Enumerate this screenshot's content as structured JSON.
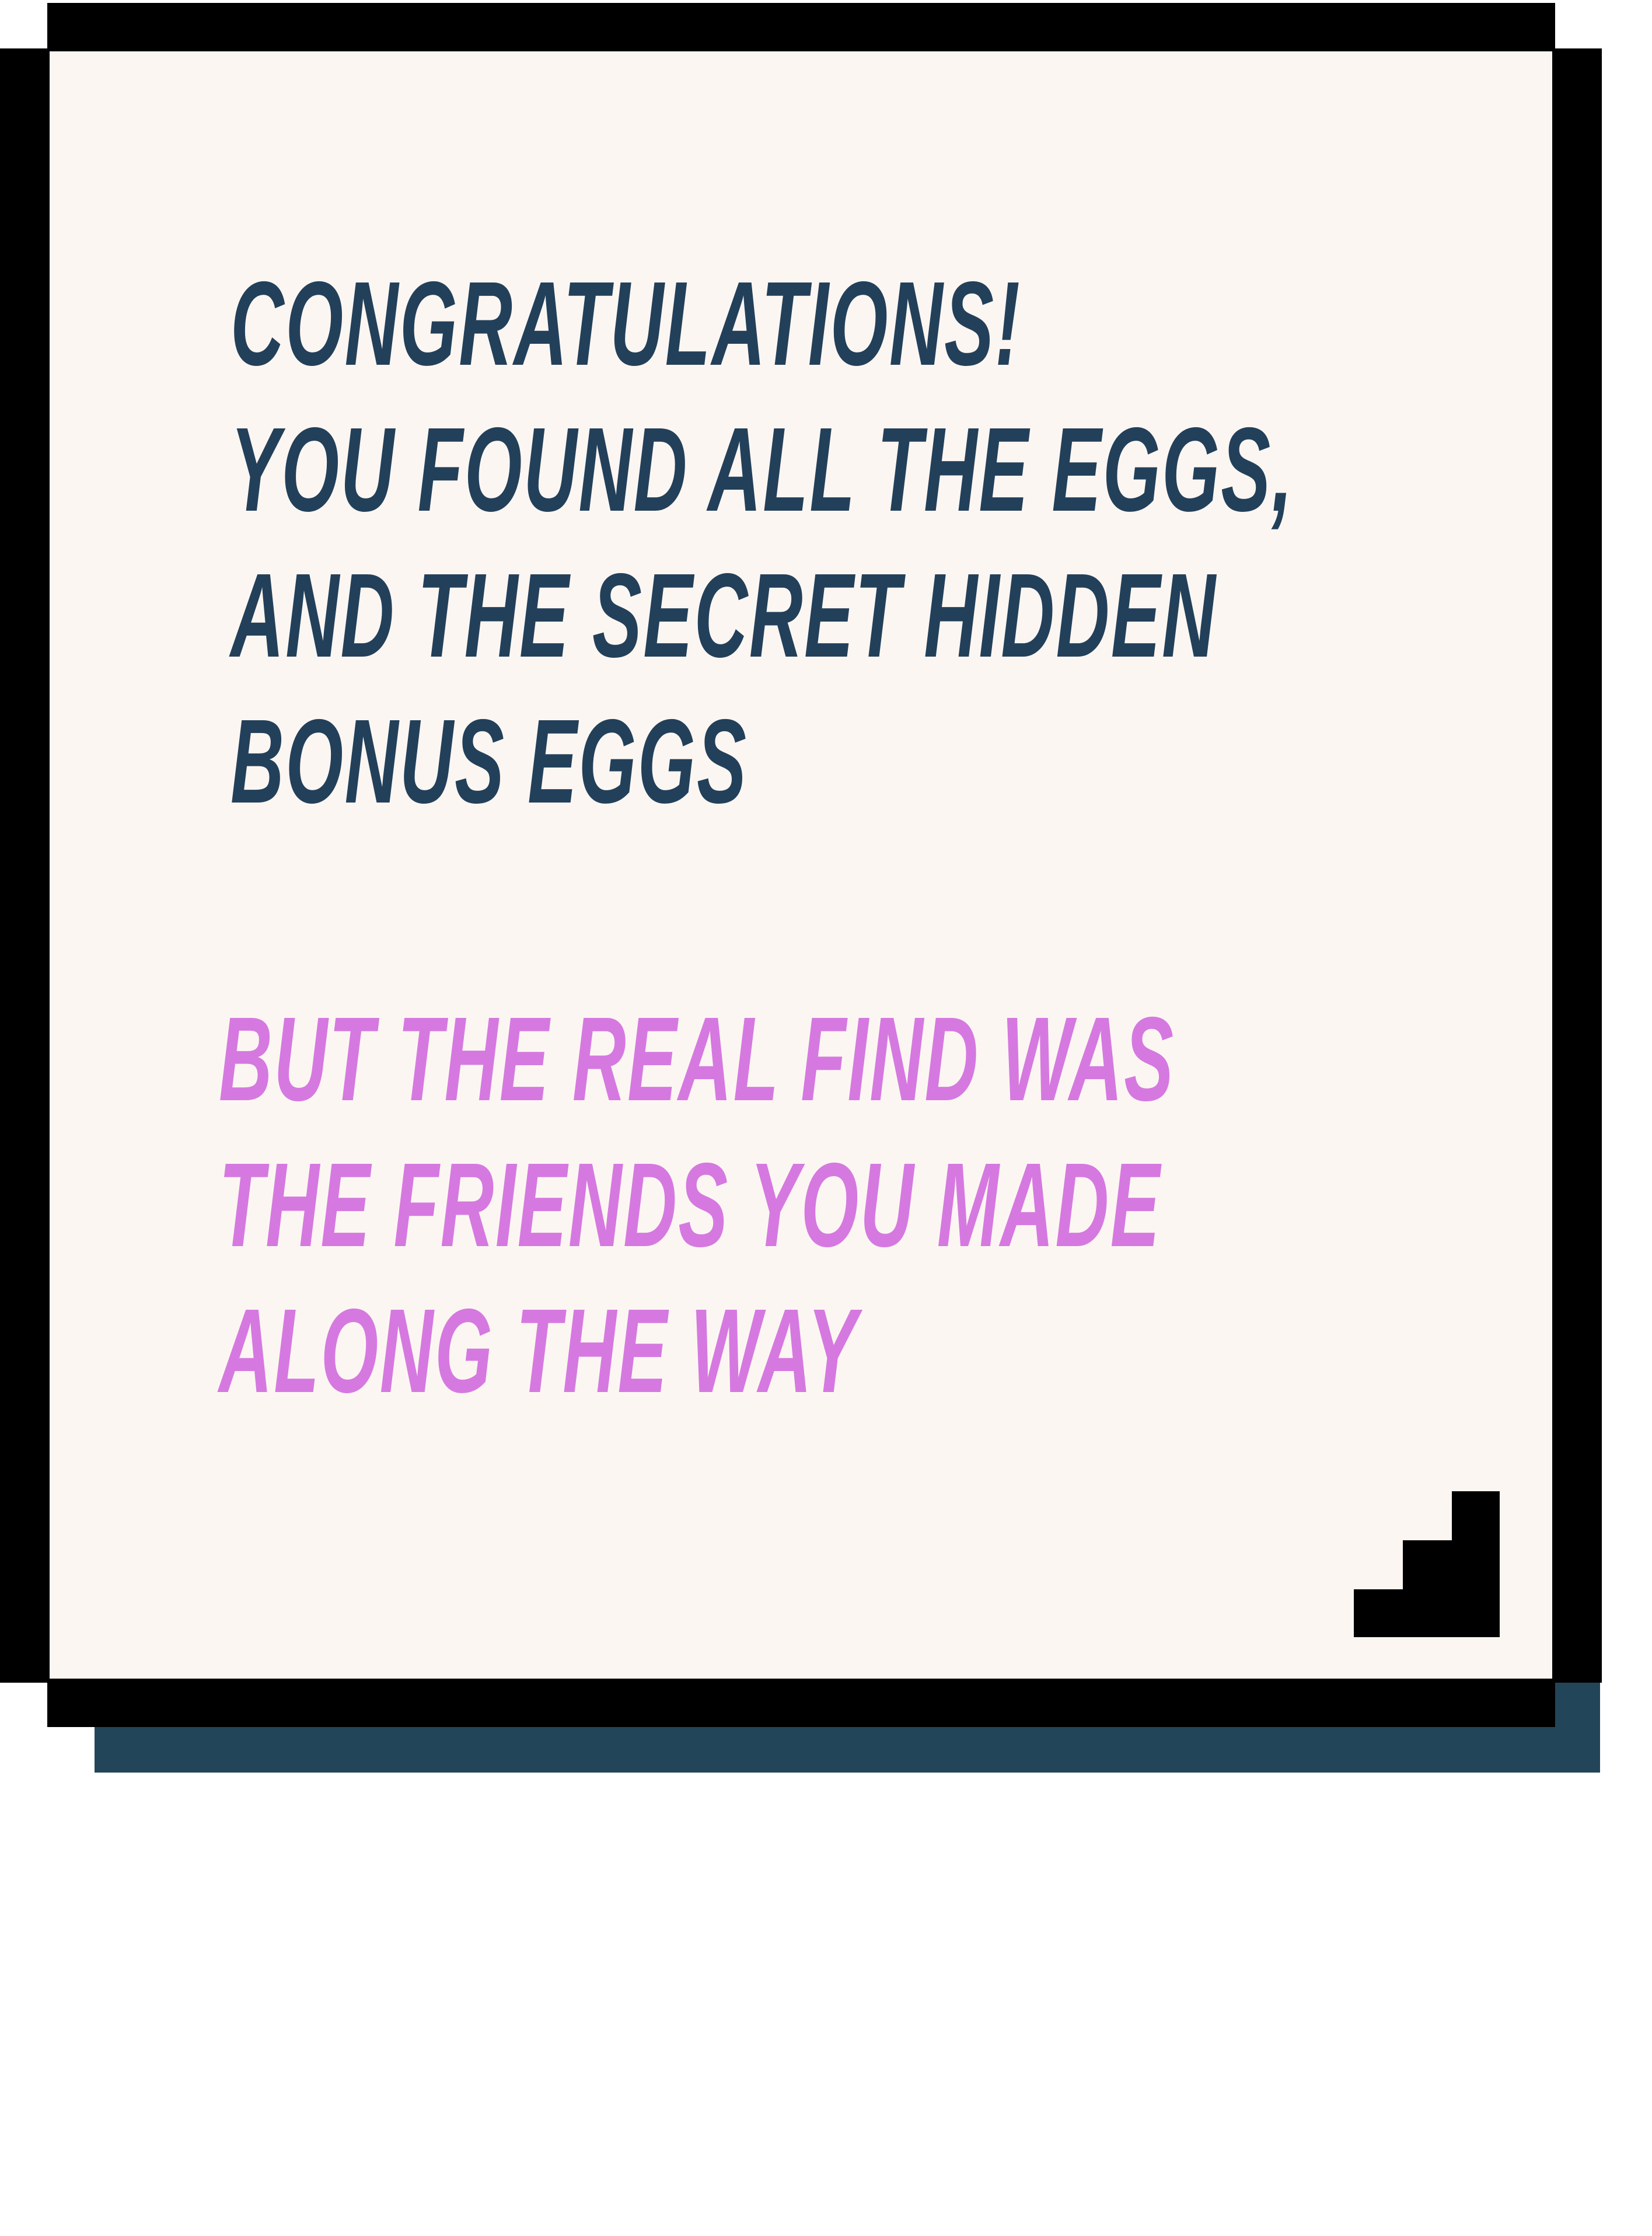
{
  "message": {
    "lines": [
      "CONGRATULATIONS!",
      "YOU FOUND ALL THE EGGS,",
      "AND THE SECRET HIDDEN",
      "BONUS EGGS"
    ],
    "punchline": [
      "BUT THE REAL FIND WAS",
      "THE FRIENDS YOU MADE",
      "ALONG THE WAY"
    ]
  },
  "colors": {
    "panel_background": "#fcf6f2",
    "border": "#000000",
    "shadow": "#23455a",
    "main_text": "#23405a",
    "punchline_text": "#d579e0"
  },
  "icons": {
    "corner": "resize-corner-icon"
  }
}
